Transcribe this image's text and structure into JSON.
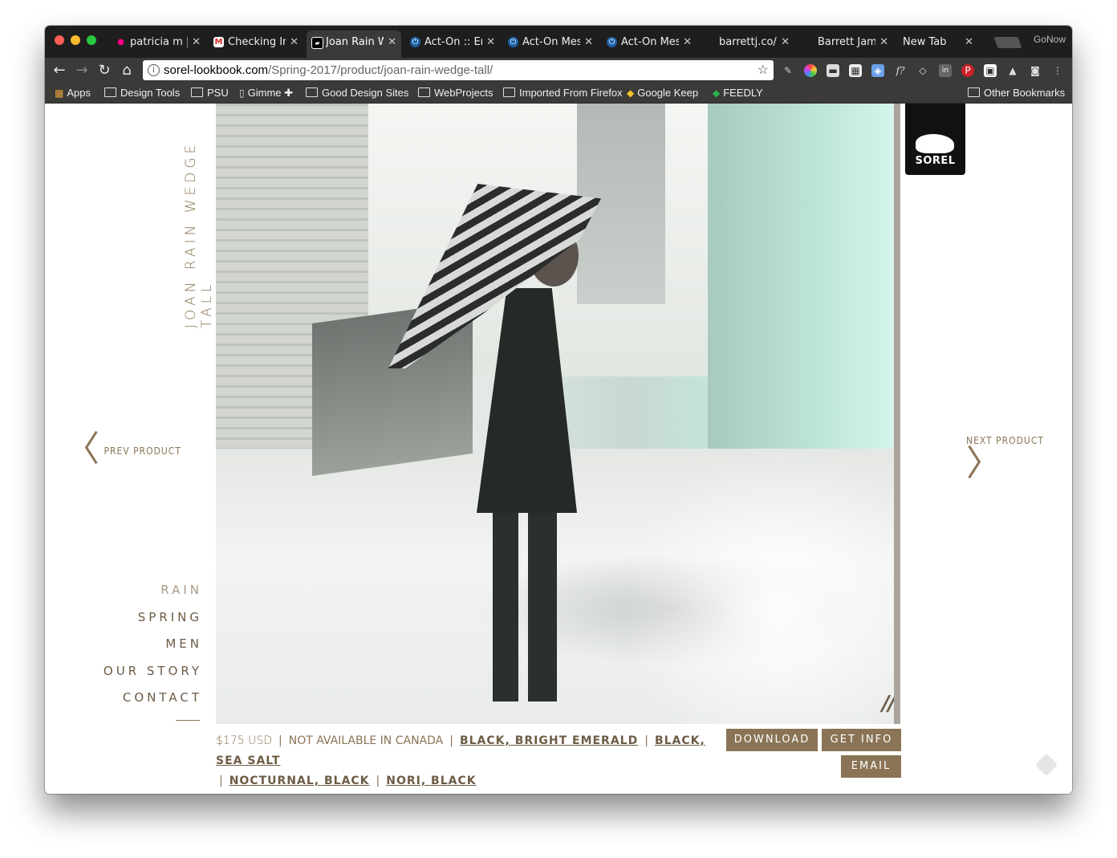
{
  "browser": {
    "tabs": [
      {
        "title": "patricia m |",
        "favicon": "flickr-icon",
        "active": false
      },
      {
        "title": "Checking In",
        "favicon": "gmail-icon",
        "active": false
      },
      {
        "title": "Joan Rain W",
        "favicon": "sorel-icon",
        "active": true
      },
      {
        "title": "Act-On :: En",
        "favicon": "acton-icon",
        "active": false
      },
      {
        "title": "Act-On Mes",
        "favicon": "acton-icon",
        "active": false
      },
      {
        "title": "Act-On Mes",
        "favicon": "acton-icon",
        "active": false
      },
      {
        "title": "barrettj.co/h",
        "favicon": "page-icon",
        "active": false
      },
      {
        "title": "Barrett Jam",
        "favicon": "page-icon",
        "active": false
      },
      {
        "title": "New Tab",
        "favicon": "none",
        "active": false
      }
    ],
    "profile": "GoNow",
    "url_host": "sorel-lookbook.com",
    "url_path": "/Spring-2017/product/joan-rain-wedge-tall/",
    "bookmarks": [
      "Apps",
      "Design Tools",
      "PSU",
      "Gimme ✚",
      "Good Design Sites",
      "WebProjects",
      "Imported From Firefox",
      "Google Keep",
      "FEEDLY"
    ],
    "other_bookmarks": "Other Bookmarks"
  },
  "page": {
    "product_title": "JOAN RAIN WEDGE TALL",
    "logo_text": "SOREL",
    "prev_label": "PREV PRODUCT",
    "next_label": "NEXT PRODUCT",
    "menu": [
      "RAIN",
      "SPRING",
      "MEN",
      "OUR STORY",
      "CONTACT"
    ],
    "price": "$175 USD",
    "availability": "NOT AVAILABLE IN CANADA",
    "colorways": [
      "BLACK, BRIGHT EMERALD",
      "BLACK, SEA SALT",
      "NOCTURNAL, BLACK",
      "NORI, BLACK"
    ],
    "buttons": {
      "download": "DOWNLOAD",
      "get_info": "GET INFO",
      "email": "EMAIL"
    },
    "separator": "|"
  },
  "colors": {
    "accent": "#8a7455",
    "logo_bg": "#111111",
    "chrome_dark": "#1e1e1e",
    "chrome_mid": "#3a3a38"
  }
}
